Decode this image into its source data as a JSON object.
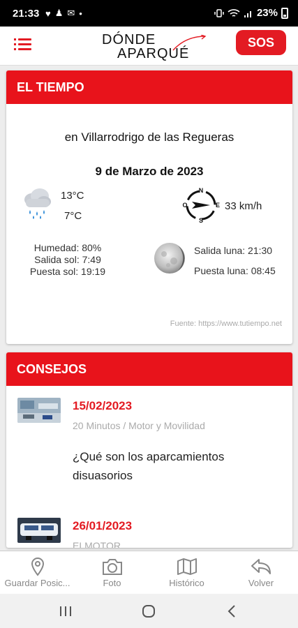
{
  "status_bar": {
    "time": "21:33",
    "battery": "23%"
  },
  "header": {
    "logo_line1": "DÓNDE",
    "logo_line2": "APARQUÉ",
    "sos_label": "SOS",
    "menu_icon": "menu-icon"
  },
  "weather": {
    "title": "EL TIEMPO",
    "place": "en Villarrodrigo de las Regueras",
    "date": "9 de Marzo de 2023",
    "temp_max": "13°C",
    "temp_min": "7°C",
    "wind_speed": "33 km/h",
    "humidity": "Humedad: 80%",
    "sunrise": "Salida sol: 7:49",
    "sunset": "Puesta sol: 19:19",
    "moonrise": "Salida luna: 21:30",
    "moonset": "Puesta luna: 08:45",
    "source": "Fuente: https://www.tutiempo.net",
    "compass": {
      "n": "N",
      "s": "S",
      "e": "E",
      "o": "O"
    }
  },
  "advice": {
    "title": "CONSEJOS",
    "items": [
      {
        "date": "15/02/2023",
        "source": "20 Minutos / Motor y Movilidad",
        "title": "¿Qué son los aparcamientos disuasorios"
      },
      {
        "date": "26/01/2023",
        "source": "ELMOTOR",
        "title": ""
      }
    ]
  },
  "bottom_nav": [
    {
      "label": "Guardar Posic...",
      "icon": "location-pin-icon"
    },
    {
      "label": "Foto",
      "icon": "camera-icon"
    },
    {
      "label": "Histórico",
      "icon": "map-icon"
    },
    {
      "label": "Volver",
      "icon": "back-arrow-icon"
    }
  ],
  "colors": {
    "accent": "#e31b23",
    "muted": "#888888"
  }
}
